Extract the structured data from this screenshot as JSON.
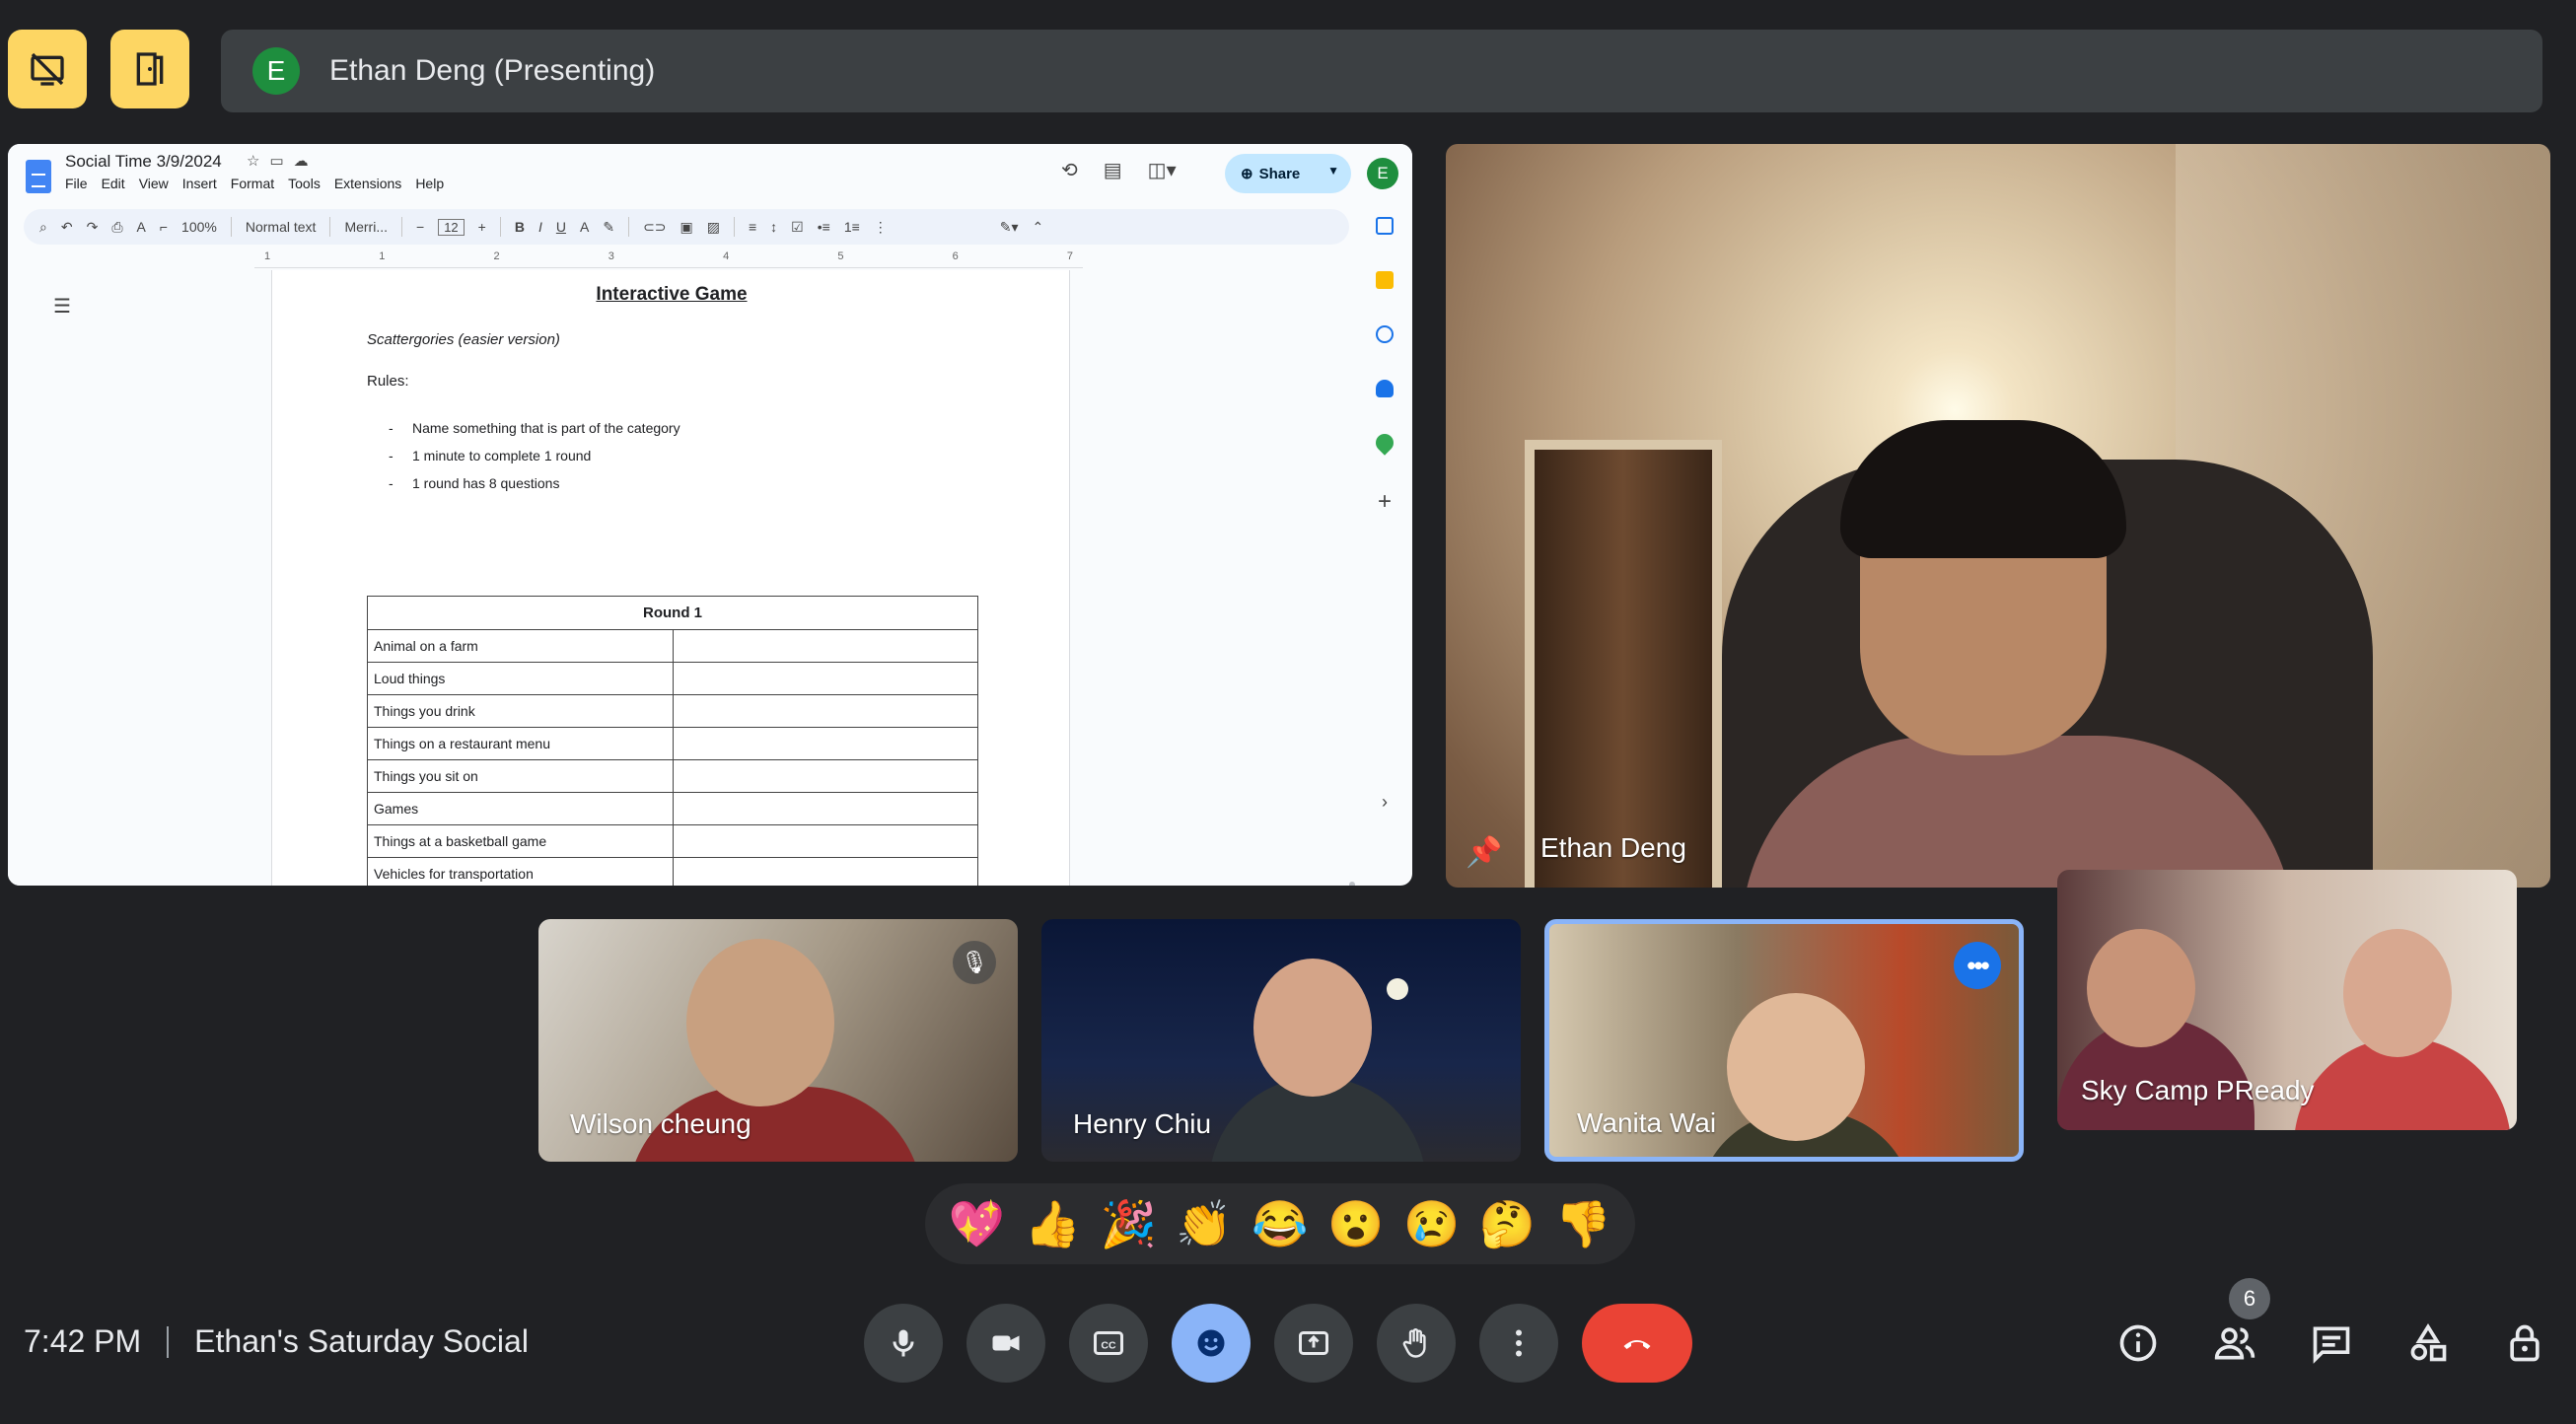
{
  "top": {
    "presenter_initial": "E",
    "presenter_label": "Ethan Deng (Presenting)"
  },
  "doc": {
    "title": "Social Time 3/9/2024",
    "menu": [
      "File",
      "Edit",
      "View",
      "Insert",
      "Format",
      "Tools",
      "Extensions",
      "Help"
    ],
    "share_label": "Share",
    "user_initial": "E",
    "toolbar": {
      "zoom": "100%",
      "style": "Normal text",
      "font": "Merri...",
      "font_size": "12"
    },
    "ruler_marks": [
      "1",
      "1",
      "2",
      "3",
      "4",
      "5",
      "6",
      "7"
    ],
    "page": {
      "heading": "Interactive Game",
      "subheading": "Scattergories (easier version)",
      "rules_label": "Rules:",
      "rules": [
        "Name something that is part of the category",
        "1 minute to complete 1 round",
        "1 round has 8 questions"
      ],
      "table_header": "Round 1",
      "table_rows": [
        "Animal on a farm",
        "Loud things",
        "Things you drink",
        "Things on a restaurant menu",
        "Things you sit on",
        "Games",
        "Things at a basketball game",
        "Vehicles for transportation"
      ]
    }
  },
  "speaker": {
    "name": "Ethan Deng"
  },
  "participants": [
    {
      "name": "Wilson cheung",
      "muted": true
    },
    {
      "name": "Henry Chiu",
      "muted": false
    },
    {
      "name": "Wanita Wai",
      "speaking": true
    },
    {
      "name": "Sky Camp PReady"
    }
  ],
  "reactions": [
    "💖",
    "👍",
    "🎉",
    "👏",
    "😂",
    "😮",
    "😢",
    "🤔",
    "👎"
  ],
  "meeting": {
    "time": "7:42 PM",
    "name": "Ethan's Saturday Social"
  },
  "people_count": "6",
  "colors": {
    "background": "#202124",
    "accent_blue": "#8ab4f8",
    "end_call_red": "#ea4335",
    "top_button_yellow": "#fdd663"
  }
}
